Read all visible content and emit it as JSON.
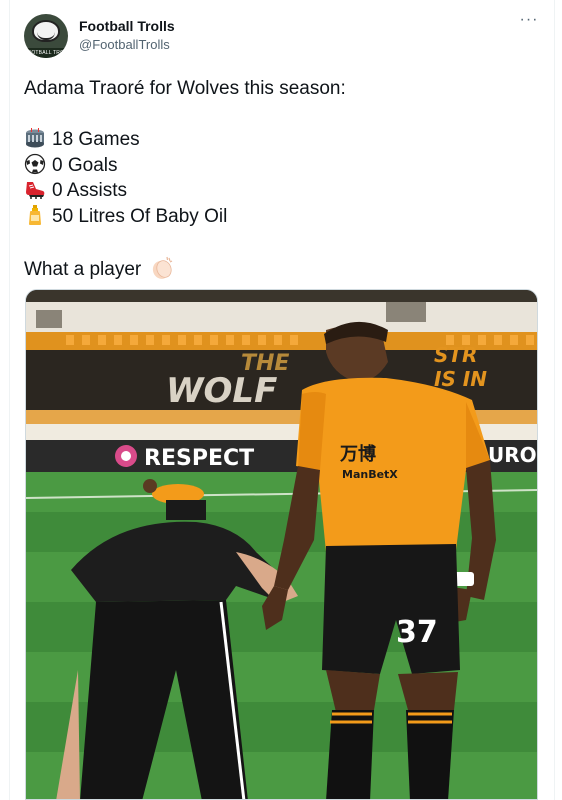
{
  "account": {
    "display_name": "Football Trolls",
    "handle": "@FootballTrolls",
    "avatar_text": "FOOTBALL TROLLS"
  },
  "menu": {
    "more_label": "···"
  },
  "tweet": {
    "intro": "Adama Traoré for Wolves this season:",
    "stats": [
      {
        "icon": "stadium-icon",
        "text": "18 Games"
      },
      {
        "icon": "soccer-ball-icon",
        "text": "0 Goals"
      },
      {
        "icon": "football-boot-icon",
        "text": "0 Assists"
      },
      {
        "icon": "baby-oil-bottle-icon",
        "text": "50 Litres Of Baby Oil"
      }
    ],
    "closing": "What a player",
    "closing_icon": "clapping-hands-icon"
  },
  "media": {
    "banner_left": "RESPECT",
    "banner_right": "URO",
    "stand_text_1": "THE",
    "stand_text_2": "WOLF",
    "stand_text_3": "STR",
    "stand_text_4": "IS IN",
    "shirt_sponsor": "万博",
    "shirt_sponsor_sub": "ManBetX",
    "shorts_number": "37"
  },
  "colors": {
    "wolves_orange": "#f39b1a",
    "pitch_green": "#3f8b3a",
    "text": "#0f1419",
    "muted": "#536471"
  }
}
